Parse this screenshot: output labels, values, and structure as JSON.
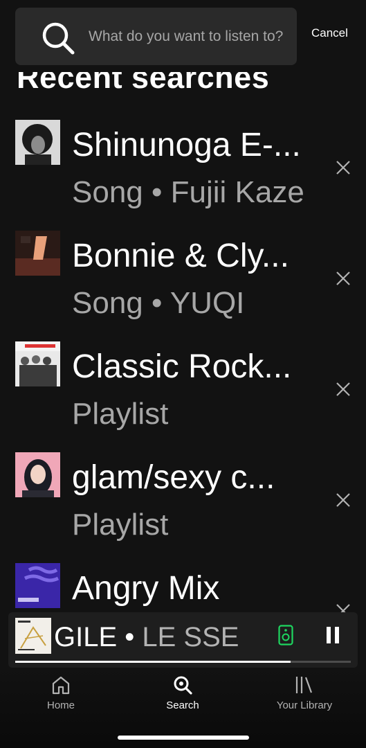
{
  "search": {
    "placeholder": "What do you want to listen to?",
    "cancel_label": "Cancel"
  },
  "section_title": "Recent searches",
  "recent": [
    {
      "title": "Shinunoga E-...",
      "subtitle": "Song • Fujii Kaze",
      "icon": "album-art"
    },
    {
      "title": "Bonnie & Cly...",
      "subtitle": "Song • YUQI",
      "icon": "album-art"
    },
    {
      "title": "Classic Rock...",
      "subtitle": "Playlist",
      "icon": "playlist-art"
    },
    {
      "title": "glam/sexy c...",
      "subtitle": "Playlist",
      "icon": "playlist-art"
    },
    {
      "title": "Angry Mix",
      "subtitle": "",
      "icon": "playlist-art"
    }
  ],
  "now_playing": {
    "title": "GILE",
    "separator": " • ",
    "artist": "LE SSE",
    "progress": 0.82,
    "accent": "#1ed760"
  },
  "tabs": [
    {
      "label": "Home",
      "icon": "home-icon",
      "active": false
    },
    {
      "label": "Search",
      "icon": "search-icon",
      "active": true
    },
    {
      "label": "Your Library",
      "icon": "library-icon",
      "active": false
    }
  ],
  "colors": {
    "background": "#121212",
    "search_bg": "#2a2a2a",
    "secondary_text": "#a7a7a7"
  }
}
